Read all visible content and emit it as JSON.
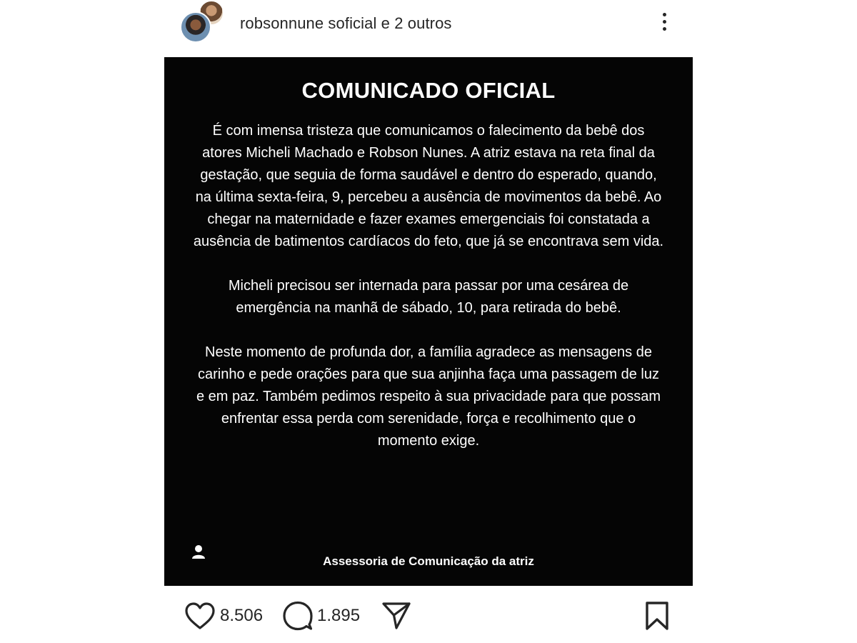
{
  "header": {
    "account_names": "robsonnune soficial e 2 outros"
  },
  "post": {
    "title": "COMUNICADO OFICIAL",
    "paragraphs": [
      "É com imensa tristeza que comunicamos o falecimento da bebê dos atores Micheli Machado e Robson Nunes. A atriz estava na reta final da gestação, que seguia de forma saudável e dentro do esperado, quando, na última sexta-feira, 9, percebeu a ausência de movimentos da bebê. Ao chegar na maternidade e fazer exames emergenciais  foi constatada a ausência de batimentos cardíacos do feto, que já se encontrava sem vida.",
      "Micheli precisou ser internada para passar por uma cesárea de emergência na manhã de sábado, 10, para retirada do bebê.",
      "Neste momento de profunda dor, a família agradece as mensagens de carinho e pede orações para que sua anjinha faça uma passagem de luz e em paz. Também pedimos respeito à sua privacidade para que possam enfrentar essa perda com serenidade, força e recolhimento que o momento exige."
    ],
    "signature": "Assessoria de Comunicação da atriz"
  },
  "actions": {
    "likes": "8.506",
    "comments": "1.895"
  },
  "icons": {
    "more": "more-vertical-icon",
    "tag": "person-tag-icon",
    "like": "heart-icon",
    "comment": "comment-bubble-icon",
    "share": "send-icon",
    "save": "bookmark-icon"
  },
  "colors": {
    "post_background": "#050505",
    "post_text": "#ffffff",
    "icon": "#262626"
  }
}
